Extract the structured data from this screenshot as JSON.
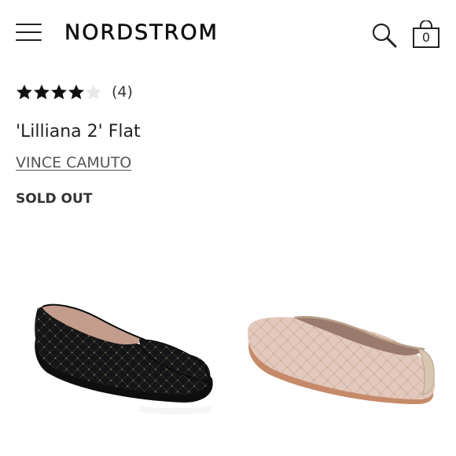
{
  "header": {
    "brand": "NORDSTROM",
    "bag_count": "0"
  },
  "product": {
    "rating_value": 4,
    "rating_max": 5,
    "review_count": "(4)",
    "title": "'Lilliana 2' Flat",
    "brand": "VINCE CAMUTO",
    "status": "SOLD OUT"
  },
  "images": [
    {
      "color": "black"
    },
    {
      "color": "blush"
    }
  ]
}
